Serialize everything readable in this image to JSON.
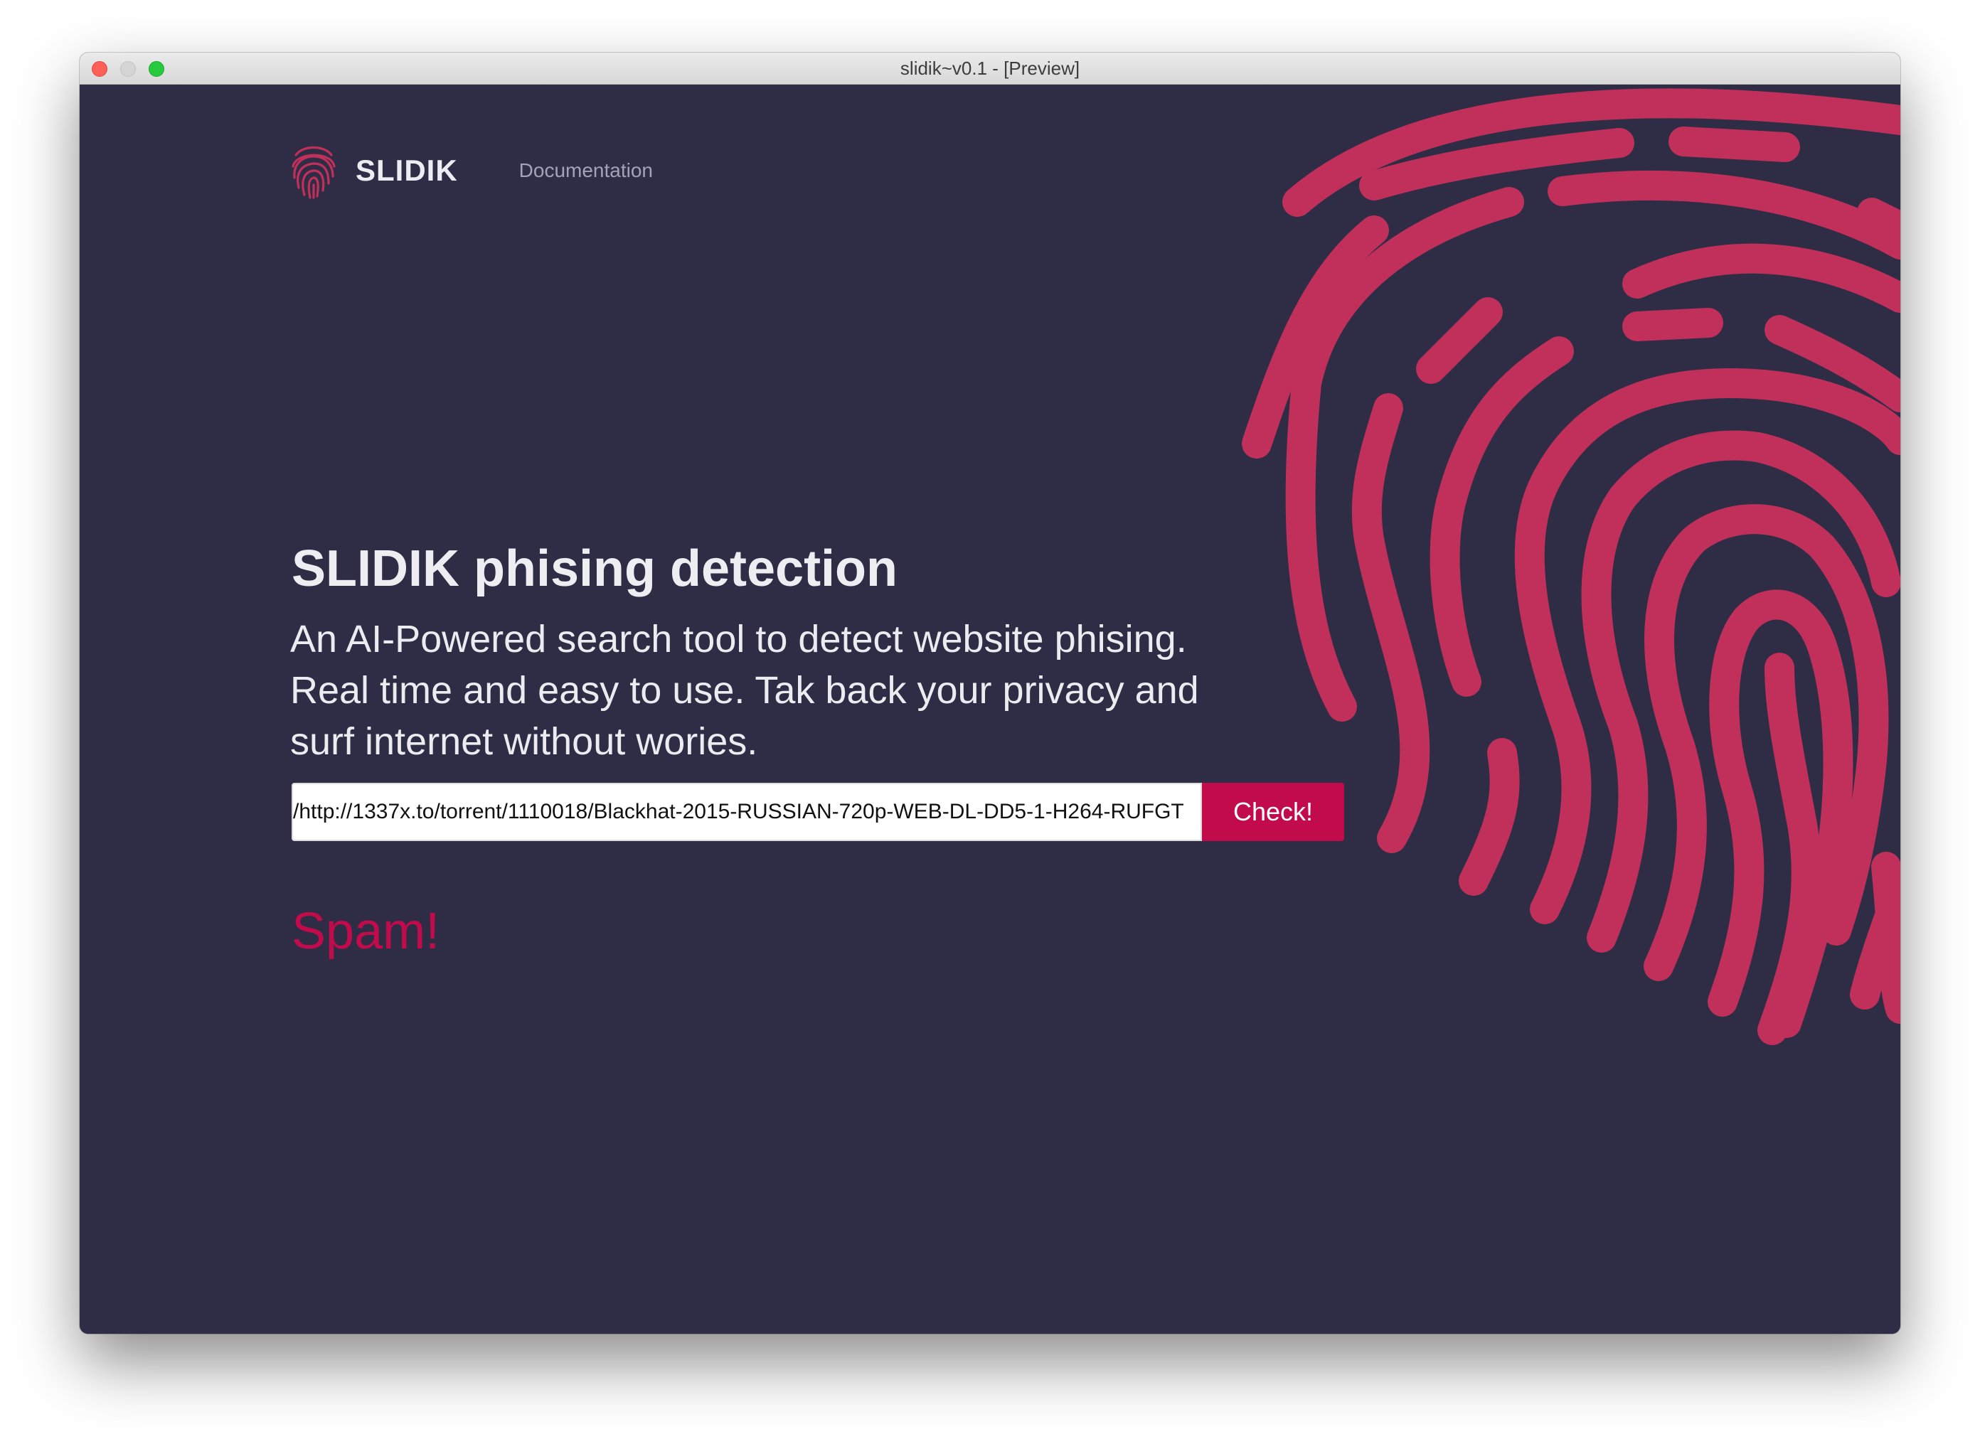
{
  "window": {
    "title": "slidik~v0.1 - [Preview]"
  },
  "nav": {
    "brand": "SLIDIK",
    "links": [
      "Documentation"
    ]
  },
  "hero": {
    "title": "SLIDIK phising detection",
    "subtitle": "An AI-Powered search tool to detect website phising. Real time and easy to use. Tak back your privacy and surf internet without wories."
  },
  "search": {
    "value": "http://1337x.to/torrent/1110018/Blackhat-2015-RUSSIAN-720p-WEB-DL-DD5-1-H264-RUFGT/",
    "button_label": "Check!"
  },
  "result": {
    "label": "Spam!"
  },
  "colors": {
    "background": "#2e2d45",
    "accent": "#c20b4b",
    "fingerprint": "#c0305a"
  },
  "icons": {
    "logo": "fingerprint-icon",
    "decoration": "fingerprint-icon"
  }
}
